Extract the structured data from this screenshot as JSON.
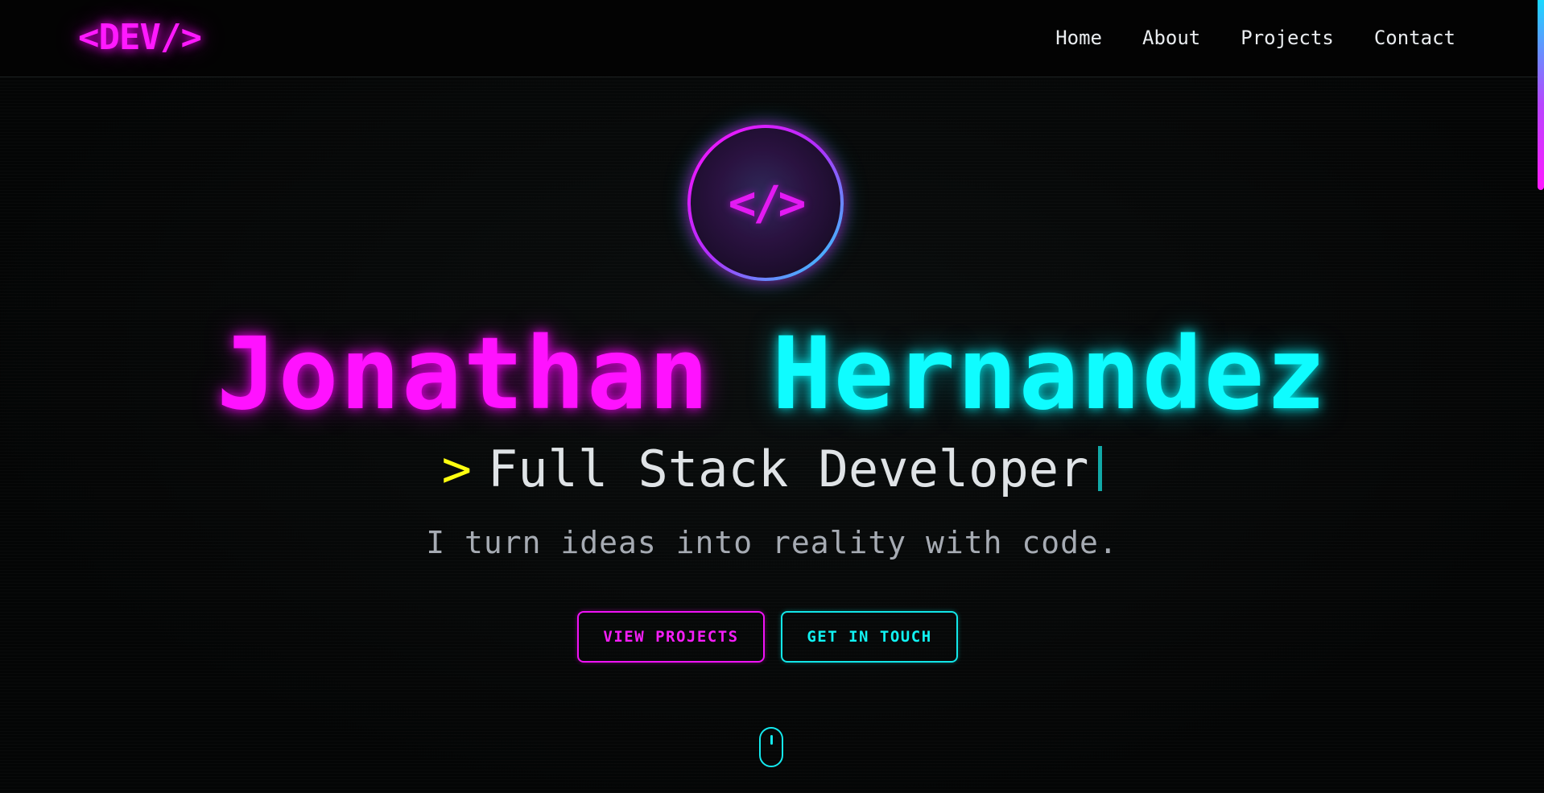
{
  "nav": {
    "logo": "<DEV/>",
    "links": [
      "Home",
      "About",
      "Projects",
      "Contact"
    ]
  },
  "hero": {
    "avatar_glyph": "</>",
    "first_name": "Jonathan",
    "last_name": "Hernandez",
    "role_prompt": ">",
    "role": "Full Stack Developer",
    "tagline": "I turn ideas into reality with code.",
    "buttons": {
      "projects": "VIEW PROJECTS",
      "contact": "GET IN TOUCH"
    }
  },
  "colors": {
    "background": "#050707",
    "accent_magenta": "#ff12ff",
    "accent_cyan": "#0ffcff",
    "accent_yellow": "#ffff10",
    "text_light": "#dfe3e6",
    "text_muted": "#a6abb3"
  },
  "icons": {
    "avatar": "code-brackets-icon",
    "scroll_hint": "mouse-scroll-icon"
  }
}
